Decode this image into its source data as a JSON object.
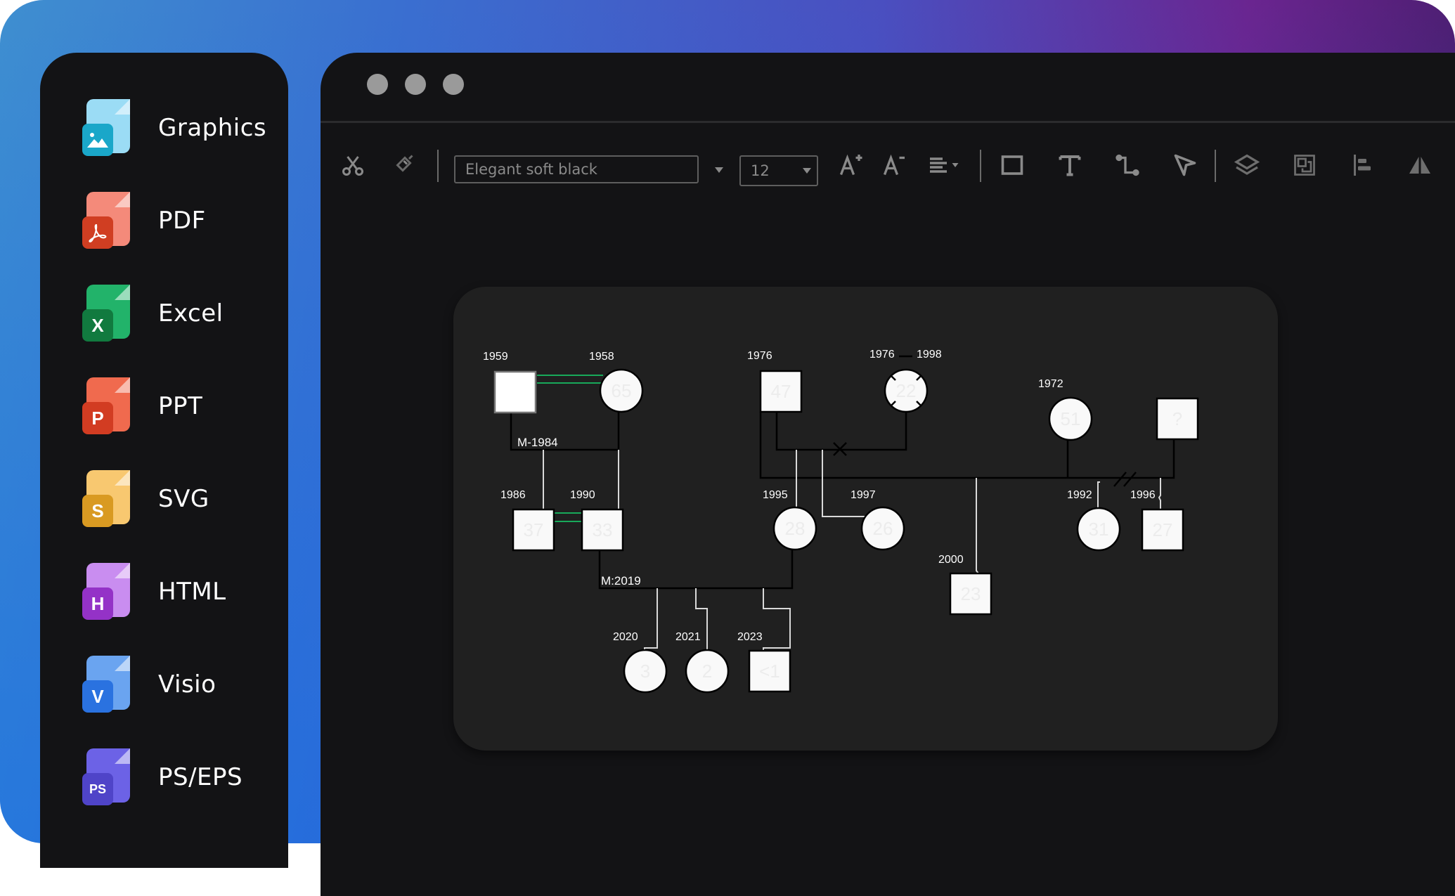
{
  "window": {
    "traffic_lights": [
      "close-dot",
      "minimize-dot",
      "maximize-dot"
    ]
  },
  "sidebar": {
    "items": [
      {
        "label": "Graphics",
        "icon": "image-file-icon",
        "badge": "",
        "back": "#9bdcf5",
        "front": "#1aa7c9"
      },
      {
        "label": "PDF",
        "icon": "pdf-file-icon",
        "badge": "",
        "back": "#f48a7a",
        "front": "#d03e22"
      },
      {
        "label": "Excel",
        "icon": "excel-file-icon",
        "badge": "X",
        "back": "#22b36a",
        "front": "#117a3f"
      },
      {
        "label": "PPT",
        "icon": "ppt-file-icon",
        "badge": "P",
        "back": "#f06a4e",
        "front": "#d23c22"
      },
      {
        "label": "SVG",
        "icon": "svg-file-icon",
        "badge": "S",
        "back": "#f8c870",
        "front": "#d99a22"
      },
      {
        "label": "HTML",
        "icon": "html-file-icon",
        "badge": "H",
        "back": "#c98df0",
        "front": "#9432c7"
      },
      {
        "label": "Visio",
        "icon": "visio-file-icon",
        "badge": "V",
        "back": "#6aa4f0",
        "front": "#2a72e0"
      },
      {
        "label": "PS/EPS",
        "icon": "ps-file-icon",
        "badge": "PS",
        "back": "#6c62e6",
        "front": "#4f44c8"
      }
    ]
  },
  "toolbar": {
    "font_name": "Elegant soft black",
    "font_size": "12",
    "icons": [
      "scissors-icon",
      "format-painter-icon",
      "font-increase-icon",
      "font-decrease-icon",
      "align-left-icon",
      "rectangle-icon",
      "text-icon",
      "connector-icon",
      "pointer-icon",
      "layers-icon",
      "group-icon",
      "align-objects-icon",
      "flip-icon"
    ]
  },
  "diagram": {
    "colors": {
      "canvas": "#202020",
      "shape_fill": "#f9f9f9",
      "marriage_line": "#18a95a",
      "line": "#000000",
      "child_line": "#d9d9d9"
    },
    "people": [
      {
        "id": "p1959",
        "shape": "square",
        "year": "1959",
        "age": ""
      },
      {
        "id": "p1958",
        "shape": "circle",
        "year": "1958",
        "age": "65"
      },
      {
        "id": "p1976m",
        "shape": "square",
        "year": "1976",
        "age": "47"
      },
      {
        "id": "p1976f",
        "shape": "circle",
        "year": "1976",
        "year_end": "1998",
        "age": "22",
        "deceased": true
      },
      {
        "id": "p1972",
        "shape": "circle",
        "year": "1972",
        "age": "51"
      },
      {
        "id": "pq",
        "shape": "square",
        "year": "",
        "age": "?"
      },
      {
        "id": "p1986",
        "shape": "square",
        "year": "1986",
        "age": "37"
      },
      {
        "id": "p1990",
        "shape": "square",
        "year": "1990",
        "age": "33"
      },
      {
        "id": "p1995",
        "shape": "circle",
        "year": "1995",
        "age": "28"
      },
      {
        "id": "p1997",
        "shape": "circle",
        "year": "1997",
        "age": "26"
      },
      {
        "id": "p2000",
        "shape": "square",
        "year": "2000",
        "age": "23"
      },
      {
        "id": "p1992",
        "shape": "circle",
        "year": "1992",
        "age": "31"
      },
      {
        "id": "p1996",
        "shape": "square",
        "year": "1996",
        "age": "27"
      },
      {
        "id": "p2020",
        "shape": "circle",
        "year": "2020",
        "age": "3"
      },
      {
        "id": "p2021",
        "shape": "circle",
        "year": "2021",
        "age": "2"
      },
      {
        "id": "p2023",
        "shape": "square",
        "year": "2023",
        "age": "<1"
      }
    ],
    "relationship_labels": {
      "marriage_1984": "M-1984",
      "marriage_2019": "M:2019"
    }
  }
}
